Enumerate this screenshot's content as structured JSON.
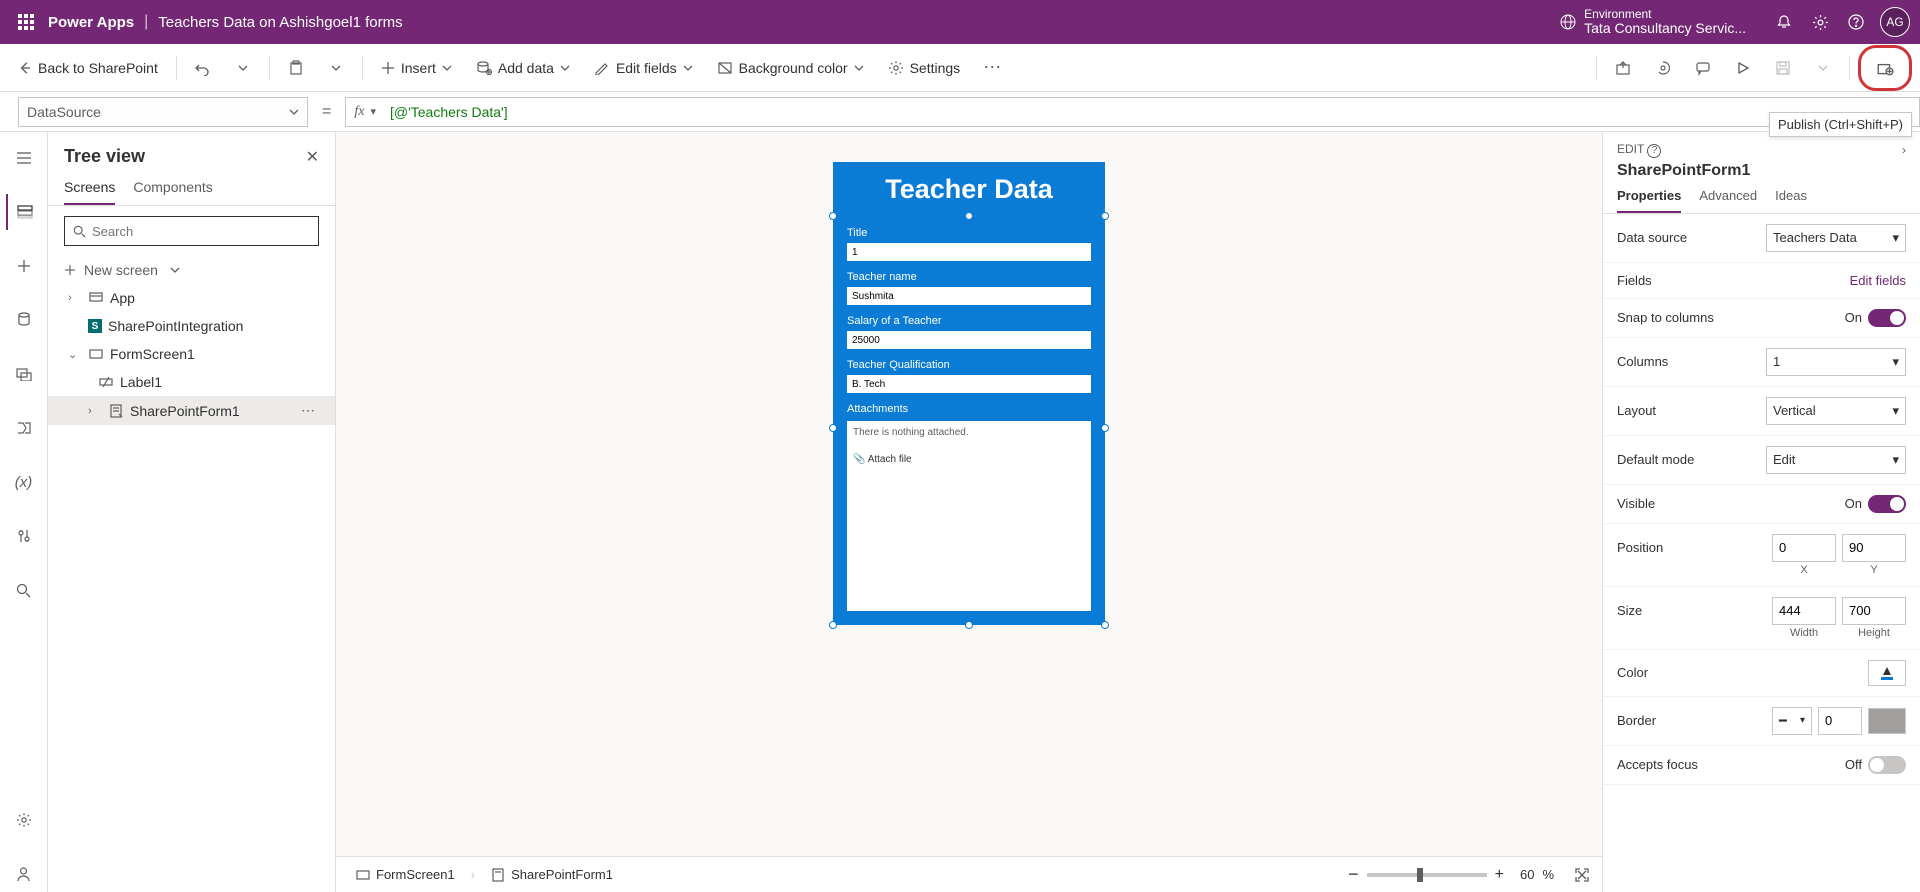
{
  "header": {
    "app": "Power Apps",
    "sep": "|",
    "title": "Teachers Data on Ashishgoel1 forms",
    "env_label": "Environment",
    "env_name": "Tata Consultancy Servic...",
    "avatar": "AG"
  },
  "cmd": {
    "back": "Back to SharePoint",
    "insert": "Insert",
    "add_data": "Add data",
    "edit_fields": "Edit fields",
    "bg_color": "Background color",
    "settings": "Settings",
    "publish_tooltip": "Publish (Ctrl+Shift+P)"
  },
  "formula": {
    "property": "DataSource",
    "value": "[@'Teachers Data']"
  },
  "tree": {
    "title": "Tree view",
    "tab_screens": "Screens",
    "tab_components": "Components",
    "search_placeholder": "Search",
    "new_screen": "New screen",
    "items": {
      "app": "App",
      "spint": "SharePointIntegration",
      "fs1": "FormScreen1",
      "lbl1": "Label1",
      "spf1": "SharePointForm1"
    }
  },
  "canvas": {
    "form_title": "Teacher Data",
    "fields": {
      "title_label": "Title",
      "title_value": "1",
      "name_label": "Teacher name",
      "name_value": "Sushmita",
      "salary_label": "Salary of a Teacher",
      "salary_value": "25000",
      "qual_label": "Teacher Qualification",
      "qual_value": "B. Tech",
      "attach_label": "Attachments",
      "attach_empty": "There is nothing attached.",
      "attach_link": "Attach file"
    }
  },
  "bottom": {
    "crumb1": "FormScreen1",
    "crumb2": "SharePointForm1",
    "zoom": "60",
    "zoom_pct": "%"
  },
  "props": {
    "edit": "EDIT",
    "name": "SharePointForm1",
    "tabs": {
      "properties": "Properties",
      "advanced": "Advanced",
      "ideas": "Ideas"
    },
    "data_source_label": "Data source",
    "data_source_value": "Teachers Data",
    "fields_label": "Fields",
    "edit_fields": "Edit fields",
    "snap_label": "Snap to columns",
    "on": "On",
    "off": "Off",
    "columns_label": "Columns",
    "columns_value": "1",
    "layout_label": "Layout",
    "layout_value": "Vertical",
    "default_mode_label": "Default mode",
    "default_mode_value": "Edit",
    "visible_label": "Visible",
    "position_label": "Position",
    "pos_x": "0",
    "pos_y": "90",
    "x_label": "X",
    "y_label": "Y",
    "size_label": "Size",
    "width": "444",
    "height": "700",
    "w_label": "Width",
    "h_label": "Height",
    "color_label": "Color",
    "border_label": "Border",
    "border_value": "0",
    "accepts_focus_label": "Accepts focus"
  }
}
